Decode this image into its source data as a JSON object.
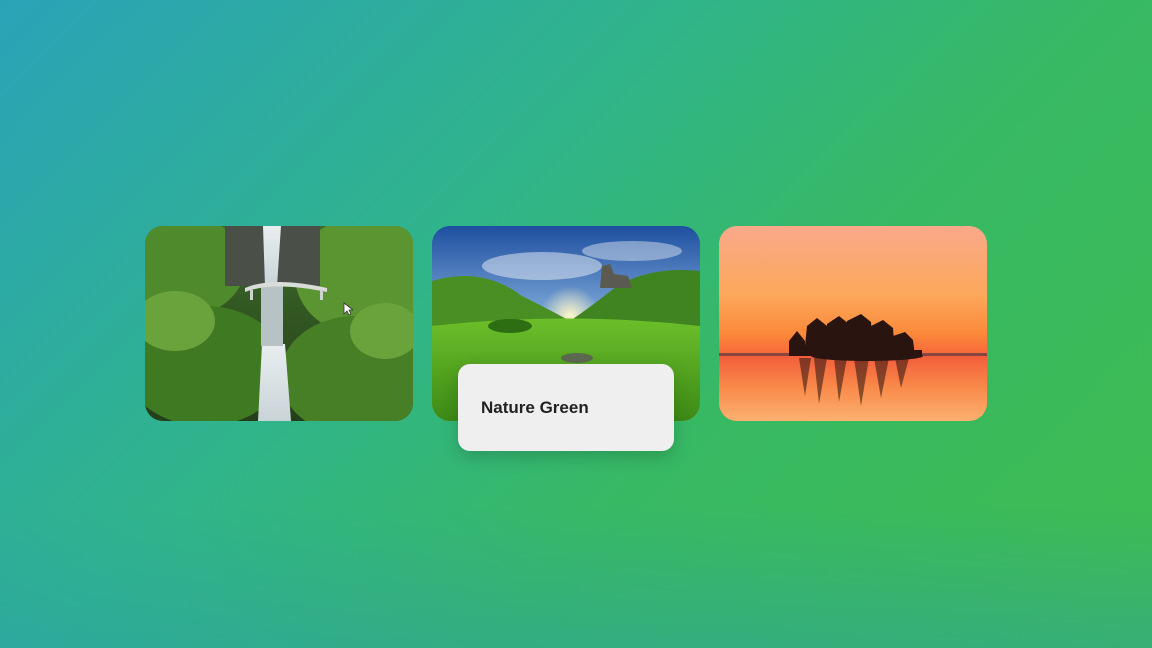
{
  "gallery": {
    "cards": [
      {
        "icon": "waterfall-photo"
      },
      {
        "icon": "green-valley-photo"
      },
      {
        "icon": "sunset-lake-photo"
      }
    ],
    "tooltip": {
      "title": "Nature Green"
    }
  },
  "colors": {
    "background_start": "#2aa3b8",
    "background_end": "#3fbc4f",
    "tooltip_bg": "#efefef",
    "tooltip_text": "#222222"
  }
}
